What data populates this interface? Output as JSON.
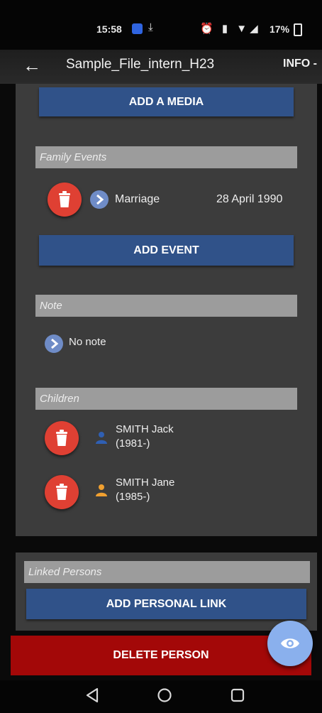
{
  "status_bar": {
    "time": "15:58",
    "notif_icon": "download-done-icon",
    "battery_percent": "17%"
  },
  "app_bar": {
    "back_icon": "arrow-left-icon",
    "title": "Sample_File_intern_H23",
    "info_label": "INFO -"
  },
  "buttons": {
    "add_media": "ADD A MEDIA",
    "add_event": "ADD EVENT",
    "add_personal_link": "ADD PERSONAL LINK",
    "delete_person": "DELETE PERSON"
  },
  "family_events": {
    "header": "Family Events",
    "events": [
      {
        "type": "Marriage",
        "date": "28 April 1990"
      }
    ]
  },
  "note": {
    "header": "Note",
    "text": "No note"
  },
  "children": {
    "header": "Children",
    "items": [
      {
        "name": "SMITH Jack",
        "years": "(1981-)",
        "gender_color": "#2f5fb3"
      },
      {
        "name": "SMITH Jane",
        "years": "(1985-)",
        "gender_color": "#f0a030"
      }
    ]
  },
  "linked_persons": {
    "header": "Linked Persons"
  },
  "fab": {
    "icon": "eye-icon"
  },
  "nav": {
    "back": "nav-back-icon",
    "home": "nav-home-icon",
    "recents": "nav-recents-icon"
  },
  "colors": {
    "accent_blue": "#305289",
    "delete_red": "#a30808",
    "trash_red": "#df4033",
    "fab": "#8ab0ed"
  }
}
